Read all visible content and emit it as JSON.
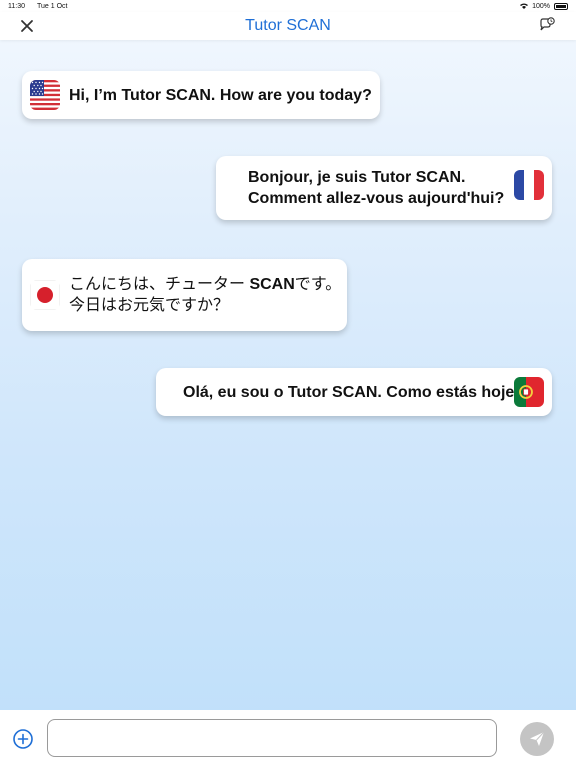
{
  "status_bar": {
    "time": "11:30",
    "date": "Tue 1 Oct",
    "battery": "100%"
  },
  "nav": {
    "title": "Tutor SCAN",
    "left_icon": "close-icon",
    "right_icon": "chat-history-icon"
  },
  "messages": [
    {
      "lang": "en",
      "flag": "us-flag-icon",
      "text": "Hi, I’m Tutor SCAN. How are you today?"
    },
    {
      "lang": "fr",
      "flag": "france-flag-icon",
      "line1": "Bonjour, je suis Tutor SCAN.",
      "line2": "Comment allez-vous aujourd'hui?"
    },
    {
      "lang": "ja",
      "flag": "japan-flag-icon",
      "line1_pre": "こんにちは、チューター ",
      "line1_bold": "SCAN",
      "line1_post": "です。",
      "line2": "今日はお元気ですか？"
    },
    {
      "lang": "pt",
      "flag": "portugal-flag-icon",
      "text": "Olá, eu sou o Tutor SCAN. Como estás hoje?"
    }
  ],
  "input": {
    "value": "",
    "placeholder": ""
  },
  "colors": {
    "accent": "#1f6fd6",
    "send_disabled": "#c4c4c4"
  }
}
